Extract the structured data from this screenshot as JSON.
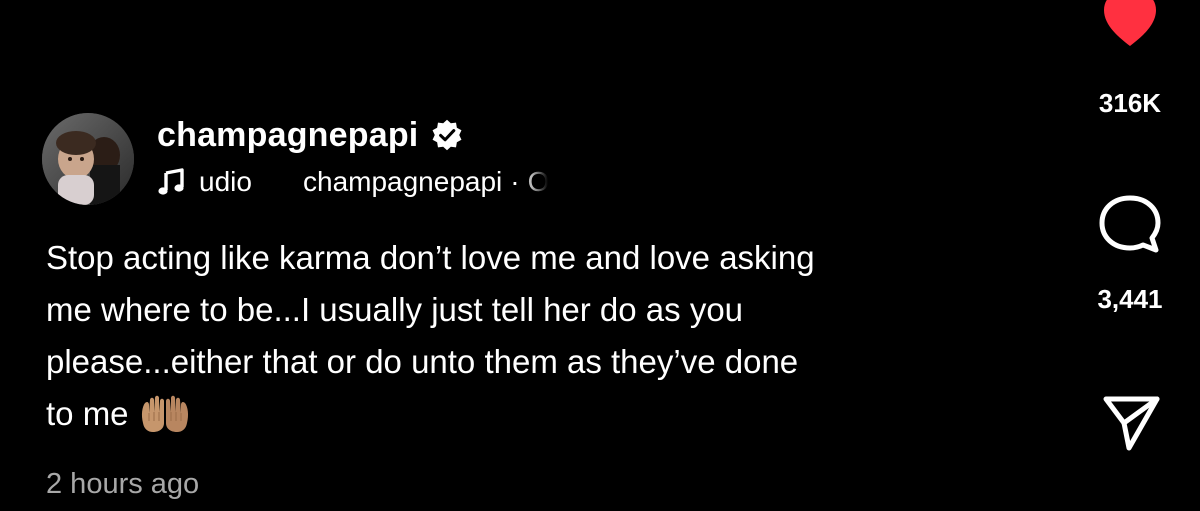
{
  "post": {
    "username": "champagnepapi",
    "audio": {
      "label_visible": "udio",
      "owner": "champagnepapi",
      "dot": "·",
      "tail": "O"
    },
    "caption_lines": [
      "Stop acting like karma don’t love me and love asking",
      "me where to be...I usually just tell her do as you",
      "please...either that or do unto them as they’ve done",
      "to me"
    ],
    "timestamp": "2 hours ago"
  },
  "actions": {
    "likes": "316K",
    "comments": "3,441",
    "like_icon": "heart-icon",
    "comment_icon": "comment-bubble-icon",
    "share_icon": "send-icon"
  },
  "colors": {
    "background": "#000000",
    "text": "#ffffff",
    "muted": "#a8a8a8",
    "like": "#ff3040"
  }
}
